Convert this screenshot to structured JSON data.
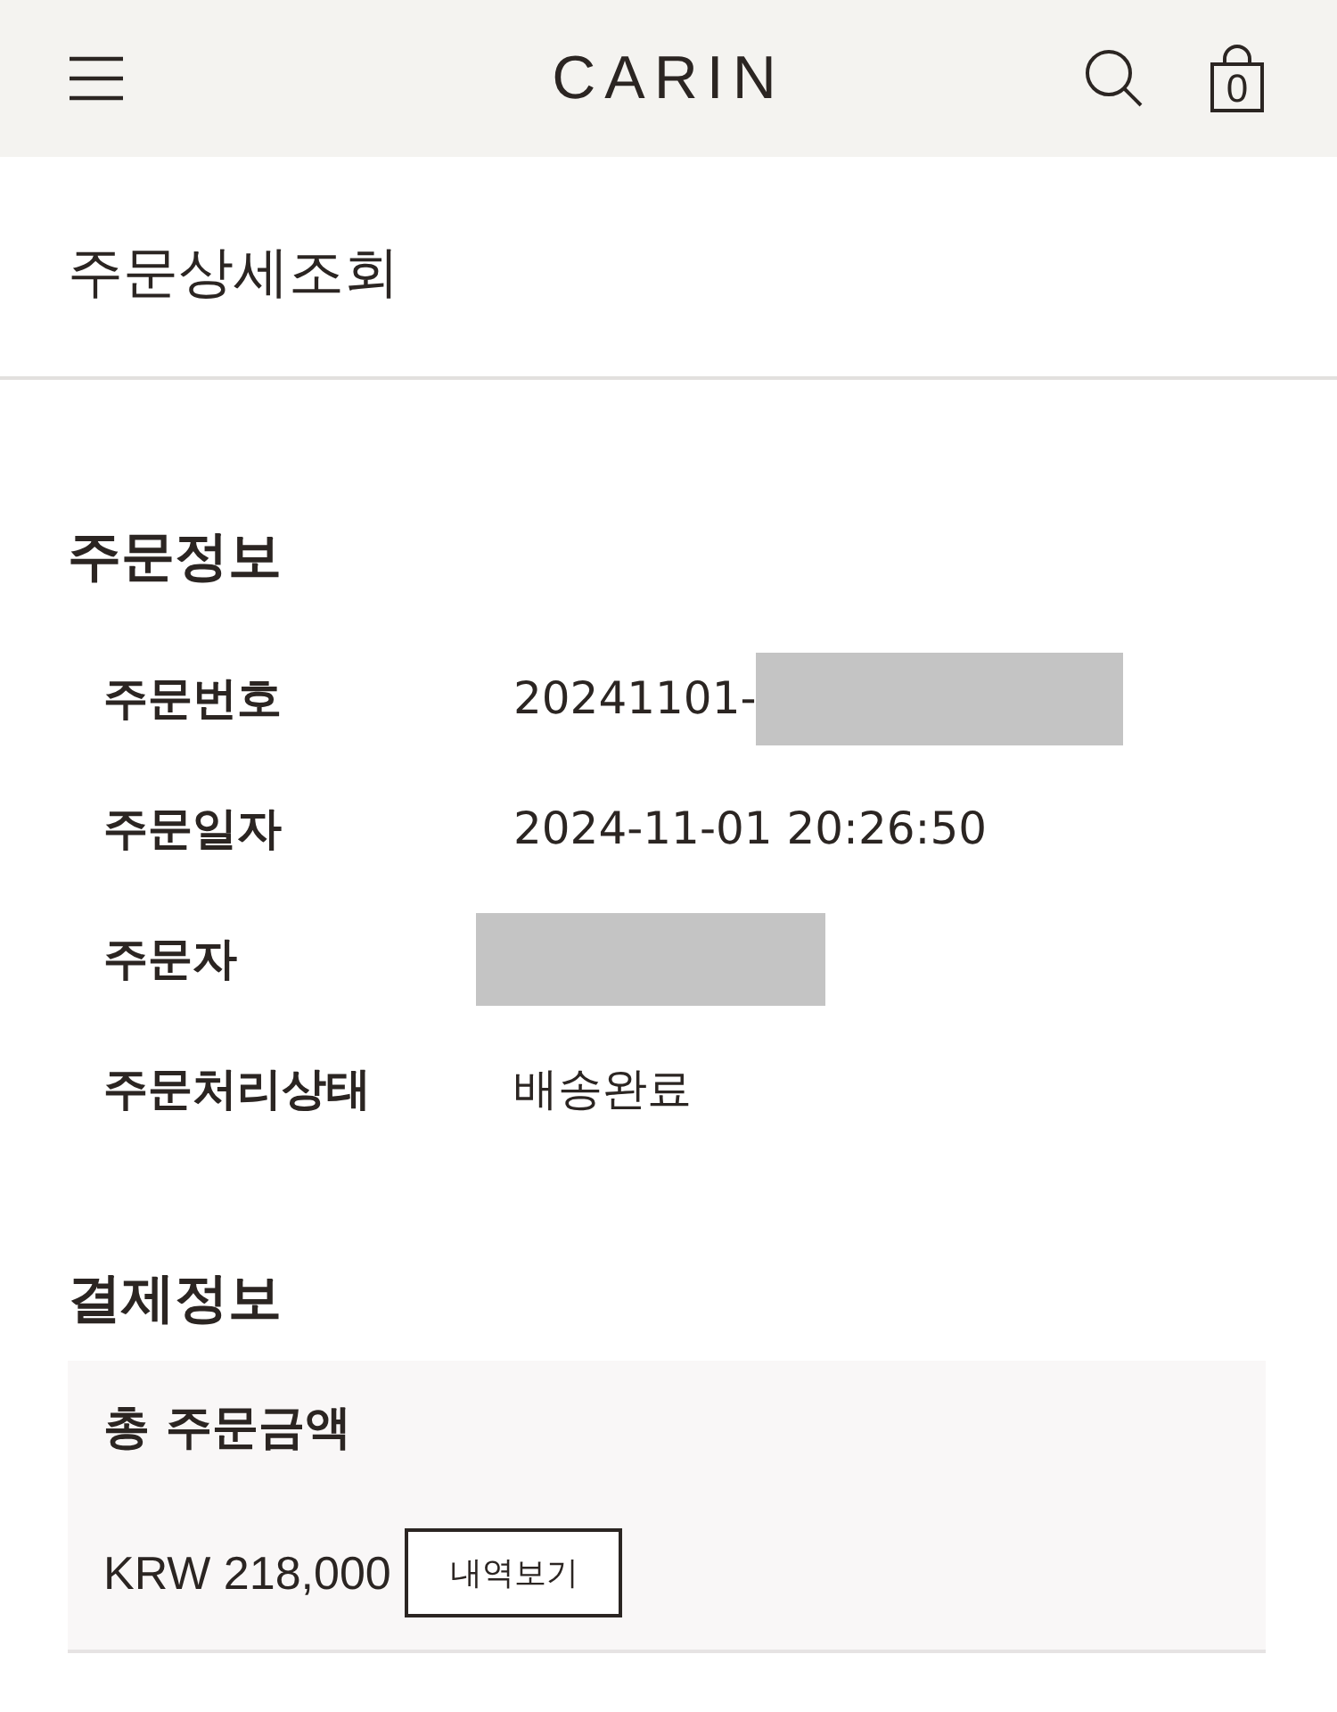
{
  "header": {
    "logo": "CARIN",
    "cart_count": "0"
  },
  "page_title": "주문상세조회",
  "order_info": {
    "heading": "주문정보",
    "rows": [
      {
        "label": "주문번호",
        "value": "20241101-",
        "redacted": true
      },
      {
        "label": "주문일자",
        "value": "2024-11-01 20:26:50",
        "redacted": false
      },
      {
        "label": "주문자",
        "redacted": true
      },
      {
        "label": "주문처리상태",
        "value": "배송완료",
        "redacted": false
      }
    ]
  },
  "payment_info": {
    "heading": "결제정보",
    "total_label": "총 주문금액",
    "total_amount": "KRW 218,000",
    "details_button": "내역보기"
  }
}
